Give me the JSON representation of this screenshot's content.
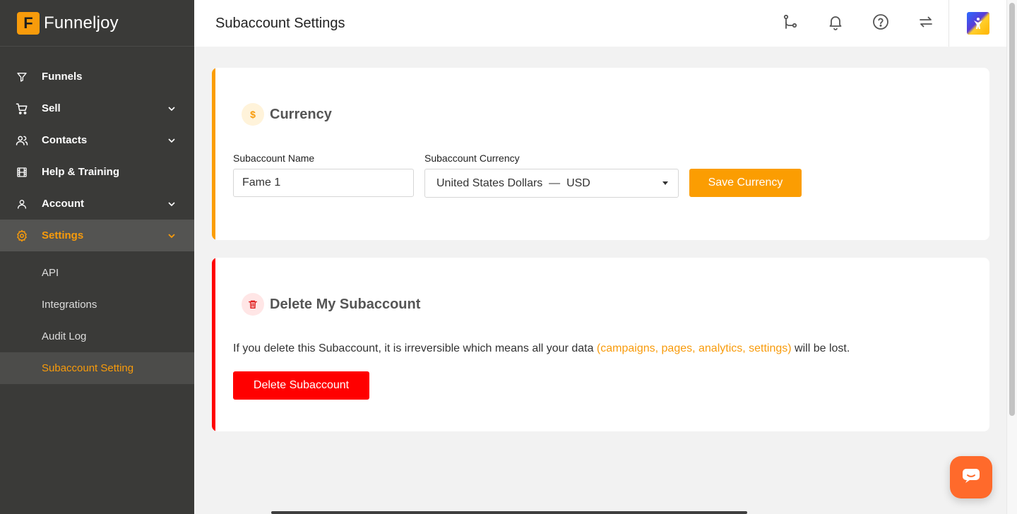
{
  "brand": {
    "logo_letter": "F",
    "name": "Funneljoy",
    "color": "#f89b0b"
  },
  "sidebar": {
    "items": [
      {
        "label": "Funnels",
        "icon": "filter-icon",
        "has_chevron": false
      },
      {
        "label": "Sell",
        "icon": "cart-icon",
        "has_chevron": true
      },
      {
        "label": "Contacts",
        "icon": "users-icon",
        "has_chevron": true
      },
      {
        "label": "Help & Training",
        "icon": "film-icon",
        "has_chevron": false
      },
      {
        "label": "Account",
        "icon": "user-icon",
        "has_chevron": true
      },
      {
        "label": "Settings",
        "icon": "gear-icon",
        "has_chevron": true,
        "active": true
      }
    ],
    "settings_subitems": [
      {
        "label": "API"
      },
      {
        "label": "Integrations"
      },
      {
        "label": "Audit Log"
      },
      {
        "label": "Subaccount Setting",
        "active": true
      }
    ]
  },
  "header": {
    "title": "Subaccount Settings",
    "icons": [
      "git-branch-icon",
      "bell-icon",
      "help-circle-icon",
      "sync-icon"
    ]
  },
  "currency_card": {
    "title": "Currency",
    "icon": "dollar-icon",
    "accent_color": "#fb9d02",
    "name_label": "Subaccount Name",
    "name_value": "Fame 1",
    "currency_label": "Subaccount Currency",
    "currency_value": "United States Dollars  —  USD",
    "save_label": "Save Currency"
  },
  "delete_card": {
    "title": "Delete My Subaccount",
    "icon": "trash-icon",
    "accent_color": "#ff0000",
    "warning_before": "If you delete this Subaccount, it is irreversible which means all your data ",
    "warning_highlight": "(campaigns, pages, analytics, settings)",
    "warning_after": " will be lost.",
    "delete_label": "Delete Subaccount"
  },
  "chat": {
    "icon": "chat-icon",
    "color": "#ff6a2b"
  }
}
